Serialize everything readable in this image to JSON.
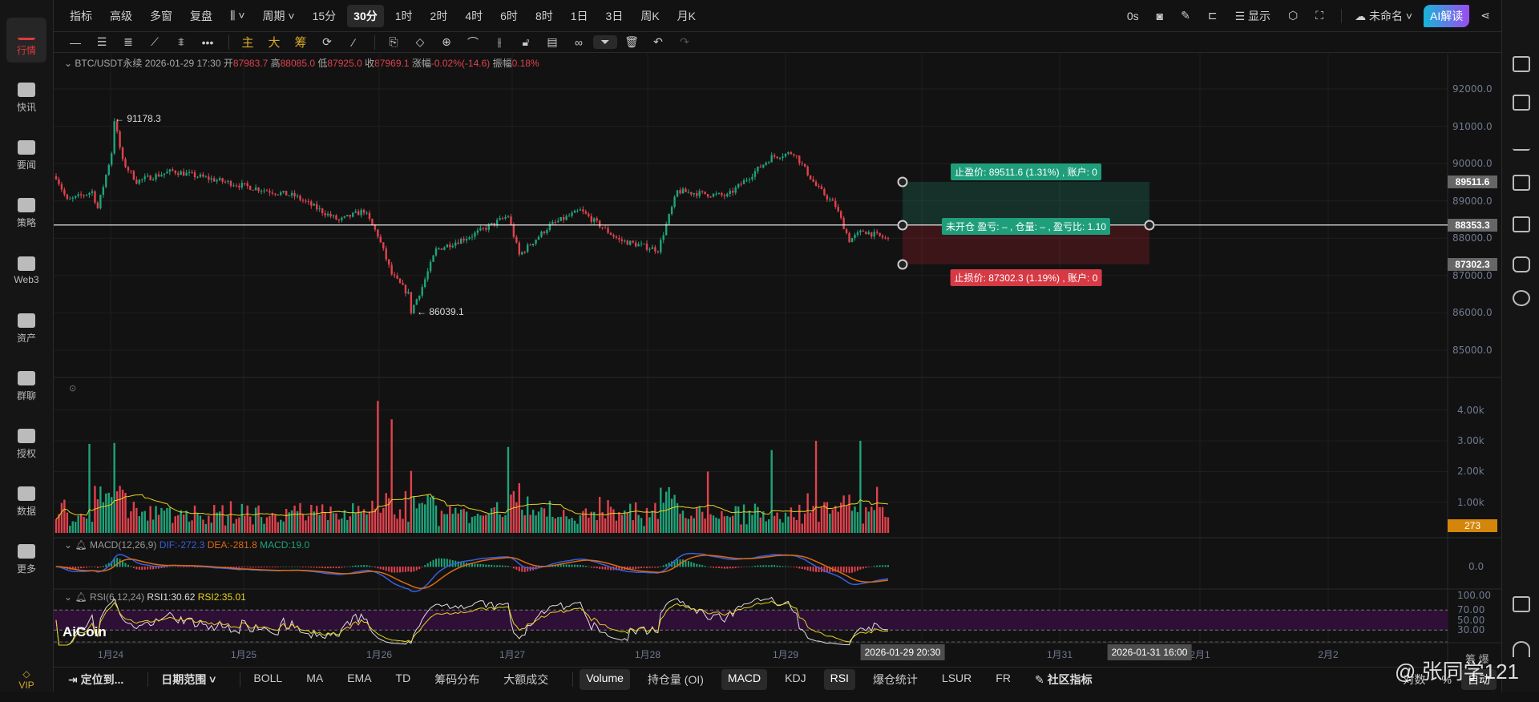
{
  "sidebar_left": {
    "items": [
      {
        "label": "行情",
        "icon": "chart-bars-icon",
        "active": true
      },
      {
        "label": "快讯",
        "icon": "news-flash-icon"
      },
      {
        "label": "要闻",
        "icon": "document-icon"
      },
      {
        "label": "策略",
        "icon": "robot-icon"
      },
      {
        "label": "Web3",
        "icon": "web3-icon"
      },
      {
        "label": "资产",
        "icon": "wallet-icon"
      },
      {
        "label": "群聊",
        "icon": "chat-icon"
      },
      {
        "label": "授权",
        "icon": "key-icon"
      },
      {
        "label": "数据",
        "icon": "data-monitor-icon"
      },
      {
        "label": "更多",
        "icon": "grid-more-icon"
      }
    ],
    "vip": "VIP"
  },
  "toolbar": {
    "indicators": "指标",
    "advanced": "高级",
    "multi_window": "多窗",
    "replay": "复盘",
    "period": "周期",
    "intervals": [
      "15分",
      "30分",
      "1时",
      "2时",
      "4时",
      "6时",
      "8时",
      "1日",
      "3日",
      "周K",
      "月K"
    ],
    "active_interval": "30分",
    "refresh": "0s",
    "display": "显示",
    "layout_name": "未命名",
    "ai_button": "AI解读",
    "drawing": {
      "main": "主",
      "big": "大",
      "chips": "筹"
    }
  },
  "info": {
    "symbol": "BTC/USDT永续",
    "time": "2026-01-29 17:30",
    "open_label": "开",
    "open": "87983.7",
    "high_label": "高",
    "high": "88085.0",
    "low_label": "低",
    "low": "87925.0",
    "close_label": "收",
    "close": "87969.1",
    "change_label": "涨幅",
    "change": "-0.02%(-14.6)",
    "amp_label": "振幅",
    "amp": "0.18%"
  },
  "price_axis": {
    "ticks": [
      "92000.0",
      "91000.0",
      "90000.0",
      "89000.0",
      "88000.0",
      "87000.0",
      "86000.0",
      "85000.0"
    ],
    "tags": {
      "take_profit": "89511.6",
      "entry": "88353.3",
      "stop_loss": "87302.3"
    }
  },
  "annotations": {
    "high": "← 91178.3",
    "low": "← 86039.1"
  },
  "position_tool": {
    "take_profit_label": "止盈价: 89511.6 (1.31%) , 账户: 0",
    "center_label": "未开仓 盈亏: – , 仓量: – , 盈亏比: 1.10",
    "stop_loss_label": "止损价: 87302.3 (1.19%) , 账户: 0",
    "colors": {
      "profit": "#1f9e7c",
      "loss": "#d63a44"
    }
  },
  "volume": {
    "ticks": [
      "4.00k",
      "3.00k",
      "2.00k",
      "1.00k"
    ],
    "current": "273"
  },
  "macd": {
    "title": "MACD(12,26,9)",
    "dif": "DIF:-272.3",
    "dea": "DEA:-281.8",
    "macd": "MACD:19.0",
    "zero": "0.0"
  },
  "rsi": {
    "title": "RSI(6,12,24)",
    "rsi1": "RSI1:30.62",
    "rsi2": "RSI2:35.01",
    "levels": [
      "100.00",
      "70.00",
      "50.00",
      "30.00"
    ]
  },
  "time_axis": {
    "labels": [
      "1月24",
      "1月25",
      "1月26",
      "1月27",
      "1月28",
      "1月29",
      "1月31",
      "2月1",
      "2月2"
    ],
    "crosshair_start": "2026-01-29 20:30",
    "crosshair_end": "2026-01-31 16:00"
  },
  "watermark": {
    "logo": "AiCoin",
    "user": "@ 张同学121"
  },
  "bottom": {
    "locate": "定位到...",
    "date_range": "日期范围",
    "main_indicators": [
      "BOLL",
      "MA",
      "EMA",
      "TD",
      "筹码分布",
      "大额成交"
    ],
    "sub_indicators": [
      {
        "label": "Volume",
        "active": true
      },
      {
        "label": "持仓量 (OI)"
      },
      {
        "label": "MACD",
        "active": true
      },
      {
        "label": "KDJ"
      },
      {
        "label": "RSI",
        "active": true
      },
      {
        "label": "爆仓统计"
      },
      {
        "label": "LSUR"
      },
      {
        "label": "FR"
      }
    ],
    "community": "社区指标",
    "log": "对数",
    "percent": "%",
    "auto": "自动",
    "chips_short": "筹",
    "liq_short": "爆"
  },
  "chart_data": {
    "type": "candlestick",
    "interval": "30m",
    "symbol": "BTC/USDT",
    "ylim": [
      84300,
      92600
    ],
    "price_anchors": [
      [
        0,
        89660
      ],
      [
        4,
        89000
      ],
      [
        13,
        89250
      ],
      [
        15,
        88800
      ],
      [
        20,
        90300
      ],
      [
        21,
        91178
      ],
      [
        24,
        90050
      ],
      [
        29,
        89530
      ],
      [
        42,
        89800
      ],
      [
        68,
        89400
      ],
      [
        86,
        89130
      ],
      [
        102,
        88470
      ],
      [
        111,
        88740
      ],
      [
        116,
        88080
      ],
      [
        121,
        87030
      ],
      [
        127,
        86500
      ],
      [
        128,
        86039
      ],
      [
        132,
        86700
      ],
      [
        137,
        87690
      ],
      [
        150,
        88080
      ],
      [
        163,
        88600
      ],
      [
        167,
        87550
      ],
      [
        178,
        88340
      ],
      [
        189,
        88740
      ],
      [
        203,
        87950
      ],
      [
        217,
        87690
      ],
      [
        224,
        89260
      ],
      [
        242,
        89130
      ],
      [
        258,
        90180
      ],
      [
        266,
        90300
      ],
      [
        274,
        89400
      ],
      [
        281,
        88870
      ],
      [
        286,
        87950
      ],
      [
        291,
        88200
      ],
      [
        300,
        87969
      ]
    ],
    "volume_spikes": [
      [
        12,
        2900
      ],
      [
        116,
        4300
      ],
      [
        121,
        3700
      ],
      [
        163,
        2800
      ],
      [
        235,
        2000
      ],
      [
        258,
        2700
      ],
      [
        274,
        3000
      ],
      [
        290,
        3000
      ],
      [
        296,
        1500
      ]
    ]
  }
}
